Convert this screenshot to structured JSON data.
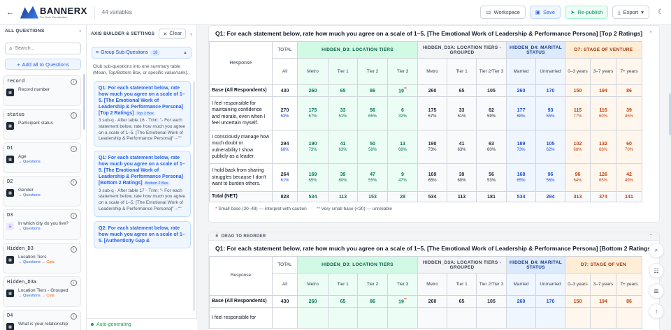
{
  "topbar": {
    "brand": "BANNERX",
    "brand_sub": "Pro Data Visualization",
    "var_count": "44 variables",
    "workspace": "Workspace",
    "save": "Save",
    "republish": "Re-publish",
    "export": "Export"
  },
  "left": {
    "title": "ALL QUESTIONS",
    "search_placeholder": "Search...",
    "add_all": "Add all to Questions",
    "questions": [
      {
        "name": "record",
        "desc": "Record number",
        "tag": "",
        "cuts": ""
      },
      {
        "name": "status",
        "desc": "Participant status",
        "tag": "",
        "cuts": ""
      },
      {
        "name": "D1",
        "desc": "Age",
        "tag": "→ Questions",
        "cuts": ""
      },
      {
        "name": "D2",
        "desc": "Gender",
        "tag": "→ Questions",
        "cuts": ""
      },
      {
        "name": "D3",
        "desc": "In which city do you live?",
        "tag": "→ Questions",
        "cuts": ""
      },
      {
        "name": "Hidden_D3",
        "desc": "Location Tiers",
        "tag": "→ Questions",
        "cuts": "→ Cuts"
      },
      {
        "name": "Hidden_D3a",
        "desc": "Location Tiers - Grouped",
        "tag": "→ Questions",
        "cuts": "→ Cuts"
      },
      {
        "name": "D4",
        "desc": "What is your relationship",
        "tag": "",
        "cuts": ""
      }
    ]
  },
  "mid": {
    "title": "AXIS BUILDER & SETTINGS",
    "clear": "Clear",
    "group_label": "Group Sub-Questions",
    "group_count": "18",
    "group_desc": "Club sub-questions into one summary table (Mean, Top/Bottom Box, or specific value/rank).",
    "cards": [
      {
        "title": "Q1: For each statement below, rate how much you agree on a scale of 1–5. [The Emotional Work of Leadership & Performance Persona] [Top 2 Ratings]",
        "tag": "Top 2 Box",
        "meta": "3 sub-q · After table 16 · Trim: \"- For each statement below, rate how much you agree on a scale of 1–5. [The Emotional Work of Leadership & Performance Persona]\"→\"\""
      },
      {
        "title": "Q1: For each statement below, rate how much you agree on a scale of 1–5. [The Emotional Work of Leadership & Performance Persona] [Bottom 2 Ratings]",
        "tag": "Bottom 2 Box",
        "meta": "3 sub-q · After table 17 · Trim: \"- For each statement below, rate how much you agree on a scale of 1–5. [The Emotional Work of Leadership & Performance Persona]\"→\"\""
      },
      {
        "title": "Q2: For each statement below, rate how much you agree on a scale of 1–5. [Authenticity Gap &",
        "tag": "",
        "meta": ""
      }
    ],
    "autogen": "Auto-generating"
  },
  "main": {
    "table1_title": "Q1: For each statement below, rate how much you agree on a scale of 1–5. [The Emotional Work of Leadership & Performance Persona] [Top 2 Ratings]",
    "table2_title": "Q1: For each statement below, rate how much you agree on a scale of 1–5. [The Emotional Work of Leadership & Performance Persona] [Bottom 2 Ratings]",
    "drag_label": "DRAG TO REORDER",
    "response_label": "Response",
    "total_label": "TOTAL",
    "all_label": "All",
    "groups": {
      "g1": "HIDDEN_D3: LOCATION TIERS",
      "g2": "HIDDEN_D3A: LOCATION TIERS - GROUPED",
      "g3": "HIDDEN_D4: MARITAL STATUS",
      "g4": "D7: STAGE OF VENTURE",
      "g4_short": "D7: STAGE OF VEN"
    },
    "cols": {
      "metro": "Metro",
      "tier1": "Tier 1",
      "tier2": "Tier 2",
      "tier3": "Tier 3",
      "metro2": "Metro",
      "tier1b": "Tier 1",
      "tier23": "Tier 2/Tier 3",
      "married": "Married",
      "unmarried": "Unmarried",
      "y03": "0–3 years",
      "y37": "3–7 years",
      "y7p": "7+ years",
      "y7p_short": "7+ years"
    },
    "base_label": "Base (All Respondents)",
    "base": [
      "430",
      "260",
      "65",
      "86",
      "19",
      "260",
      "65",
      "105",
      "260",
      "170",
      "150",
      "194",
      "86"
    ],
    "base_mark": "**",
    "rows": [
      {
        "label": "I feel responsible for maintaining confidence and morale, even when I feel uncertain myself.",
        "v": [
          "270",
          "175",
          "33",
          "56",
          "6",
          "175",
          "33",
          "62",
          "177",
          "93",
          "115",
          "116",
          "39"
        ],
        "p": [
          "63%",
          "67%",
          "51%",
          "65%",
          "32%",
          "67%",
          "51%",
          "59%",
          "68%",
          "55%",
          "77%",
          "60%",
          "45%"
        ]
      },
      {
        "label": "I consciously manage how much doubt or vulnerability I show publicly as a leader.",
        "v": [
          "294",
          "190",
          "41",
          "50",
          "13",
          "190",
          "41",
          "63",
          "189",
          "105",
          "102",
          "132",
          "60"
        ],
        "p": [
          "68%",
          "73%",
          "63%",
          "58%",
          "68%",
          "73%",
          "63%",
          "60%",
          "73%",
          "62%",
          "68%",
          "68%",
          "70%"
        ]
      },
      {
        "label": "I hold back from sharing struggles because I don't want to burden others.",
        "v": [
          "264",
          "169",
          "39",
          "47",
          "9",
          "169",
          "39",
          "56",
          "168",
          "96",
          "96",
          "126",
          "42"
        ],
        "p": [
          "61%",
          "65%",
          "60%",
          "55%",
          "47%",
          "65%",
          "60%",
          "53%",
          "65%",
          "56%",
          "64%",
          "65%",
          "49%"
        ]
      }
    ],
    "net_label": "Total (NET)",
    "net": [
      "828",
      "534",
      "113",
      "153",
      "28",
      "534",
      "113",
      "181",
      "534",
      "294",
      "313",
      "374",
      "141"
    ],
    "foot1": "Small base (30–49) — interpret with caution",
    "foot2": "Very small base (<30) — unreliable",
    "foot_star1": "*",
    "foot_star2": "**",
    "t2_row_label": "I feel responsible for"
  },
  "colors": {
    "accent": "#2563eb",
    "green": "#059669",
    "orange": "#c2410c"
  }
}
